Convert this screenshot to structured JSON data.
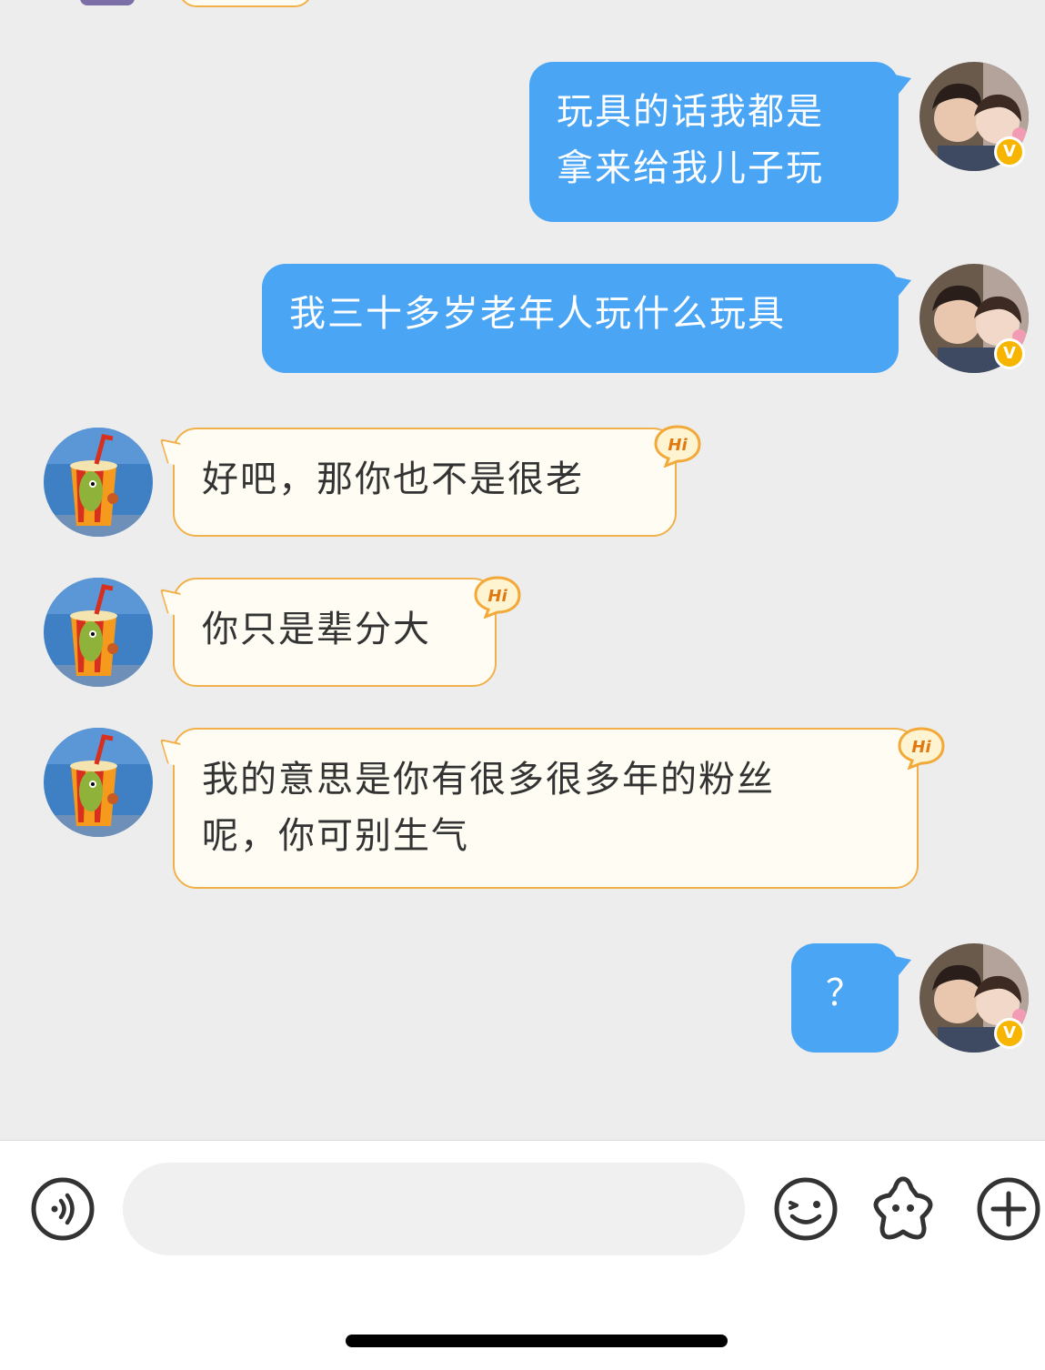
{
  "messages": [
    {
      "side": "out",
      "text_lines": [
        "玩具的话我都是",
        "拿来给我儿子玩"
      ]
    },
    {
      "side": "out",
      "text_lines": [
        "我三十多岁老年人玩什么玩具"
      ]
    },
    {
      "side": "in",
      "text_lines": [
        "好吧，那你也不是很老"
      ],
      "badge": "Hi"
    },
    {
      "side": "in",
      "text_lines": [
        "你只是辈分大"
      ],
      "badge": "Hi"
    },
    {
      "side": "in",
      "text_lines": [
        "我的意思是你有很多很多年的粉丝",
        "呢，你可别生气"
      ],
      "badge": "Hi"
    },
    {
      "side": "out",
      "text_lines": [
        "？"
      ]
    }
  ],
  "verify_badge": "V",
  "input_bar": {
    "input_value": "",
    "icons": [
      "voice-icon",
      "emoji-icon",
      "sticker-icon",
      "plus-icon"
    ]
  },
  "colors": {
    "outgoing_bubble": "#4aa5f5",
    "incoming_bubble_bg": "#fffdf3",
    "incoming_bubble_border": "#f2b04a",
    "chat_background": "#ededed",
    "verify_badge": "#f7b500"
  }
}
